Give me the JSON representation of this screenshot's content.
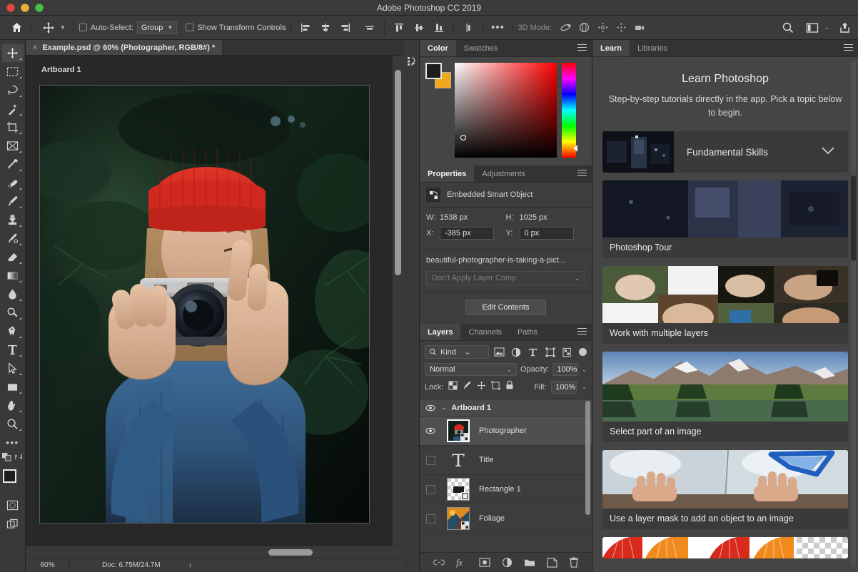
{
  "window": {
    "title": "Adobe Photoshop CC 2019",
    "traffic_lights": [
      "close",
      "minimize",
      "zoom"
    ]
  },
  "options_bar": {
    "home_icon": "home-icon",
    "tool_icon": "move-tool-icon",
    "auto_select_label": "Auto-Select:",
    "auto_select_checked": false,
    "group_value": "Group",
    "show_transform_label": "Show Transform Controls",
    "show_transform_checked": false,
    "align_icons": [
      "align-left-edges-icon",
      "align-horizontal-centers-icon",
      "align-right-edges-icon",
      "distribute-horizontally-icon",
      "align-top-edges-icon",
      "align-vertical-centers-icon",
      "align-bottom-edges-icon",
      "distribute-vertically-icon"
    ],
    "more_label": "•••",
    "mode_3d_label": "3D Mode:",
    "mode_3d_icons": [
      "orbit-3d-icon",
      "roll-3d-icon",
      "pan-3d-icon",
      "slide-3d-icon",
      "camera-3d-icon"
    ],
    "search_icon": "search-icon",
    "workspace_icon": "workspace-icon",
    "workspace_chevron": "chevron-down-icon",
    "share_icon": "share-icon"
  },
  "toolbar": {
    "tools": [
      {
        "name": "move-tool",
        "active": true
      },
      {
        "name": "rectangular-marquee-tool",
        "active": false
      },
      {
        "name": "lasso-tool",
        "active": false
      },
      {
        "name": "magic-wand-tool",
        "active": false
      },
      {
        "name": "crop-tool",
        "active": false
      },
      {
        "name": "frame-tool",
        "active": false
      },
      {
        "name": "eyedropper-tool",
        "active": false
      },
      {
        "name": "healing-brush-tool",
        "active": false
      },
      {
        "name": "brush-tool",
        "active": false
      },
      {
        "name": "clone-stamp-tool",
        "active": false
      },
      {
        "name": "history-brush-tool",
        "active": false
      },
      {
        "name": "eraser-tool",
        "active": false
      },
      {
        "name": "gradient-tool",
        "active": false
      },
      {
        "name": "blur-tool",
        "active": false
      },
      {
        "name": "dodge-tool",
        "active": false
      },
      {
        "name": "pen-tool",
        "active": false
      },
      {
        "name": "type-tool",
        "active": false
      },
      {
        "name": "path-selection-tool",
        "active": false
      },
      {
        "name": "rectangle-tool",
        "active": false
      },
      {
        "name": "hand-tool",
        "active": false
      },
      {
        "name": "zoom-tool",
        "active": false
      }
    ],
    "more_tools_label": "•••",
    "foreground_color": "#1d1d1d",
    "background_color": "#f0a81e",
    "quick_mask_icon": "quick-mask-icon",
    "screen_mode_icon": "screen-mode-icon"
  },
  "document": {
    "tab_label": "Example.psd @ 60% (Photographer, RGB/8#) *",
    "close_icon": "close-icon",
    "artboard_label": "Artboard 1"
  },
  "status_bar": {
    "zoom": "60%",
    "doc_info": "Doc: 6.75M/24.7M",
    "arrow": "›"
  },
  "color_panel": {
    "tabs": [
      {
        "label": "Color",
        "active": true
      },
      {
        "label": "Swatches",
        "active": false
      }
    ],
    "foreground_color": "#1d1d1d",
    "background_color": "#f0a81e"
  },
  "properties_panel": {
    "tabs": [
      {
        "label": "Properties",
        "active": true
      },
      {
        "label": "Adjustments",
        "active": false
      }
    ],
    "object_type": "Embedded Smart Object",
    "object_icon": "smart-object-icon",
    "width_label": "W:",
    "width_value": "1538 px",
    "height_label": "H:",
    "height_value": "1025 px",
    "x_label": "X:",
    "x_value": "-385 px",
    "y_label": "Y:",
    "y_value": "0 px",
    "file_name": "beautiful-photographer-is-taking-a-pict...",
    "layer_comp": "Don't Apply Layer Comp",
    "edit_contents_label": "Edit Contents"
  },
  "layers_panel": {
    "tabs": [
      {
        "label": "Layers",
        "active": true
      },
      {
        "label": "Channels",
        "active": false
      },
      {
        "label": "Paths",
        "active": false
      }
    ],
    "filter_label": "Kind",
    "filter_icons": [
      "pixel-filter-icon",
      "adjustment-filter-icon",
      "type-filter-icon",
      "shape-filter-icon",
      "smart-object-filter-icon"
    ],
    "blend_mode": "Normal",
    "opacity_label": "Opacity:",
    "opacity_value": "100%",
    "lock_label": "Lock:",
    "lock_icons": [
      "lock-transparent-pixels-icon",
      "lock-image-pixels-icon",
      "lock-position-icon",
      "lock-artboard-nesting-icon",
      "lock-all-icon"
    ],
    "fill_label": "Fill:",
    "fill_value": "100%",
    "layers": [
      {
        "name": "Artboard 1",
        "type": "group",
        "visible": true,
        "selected": false,
        "expanded": true
      },
      {
        "name": "Photographer",
        "type": "smart-object",
        "visible": true,
        "selected": true
      },
      {
        "name": "Title",
        "type": "text",
        "visible": false,
        "selected": false
      },
      {
        "name": "Rectangle 1",
        "type": "shape",
        "visible": false,
        "selected": false
      },
      {
        "name": "Foliage",
        "type": "smart-object",
        "visible": false,
        "selected": false
      }
    ],
    "footer_icons": [
      "link-layers-icon",
      "layer-style-fx-icon",
      "add-layer-mask-icon",
      "new-adjustment-layer-icon",
      "new-group-icon",
      "new-layer-icon",
      "delete-layer-icon"
    ]
  },
  "learn_panel": {
    "tabs": [
      {
        "label": "Learn",
        "active": true
      },
      {
        "label": "Libraries",
        "active": false
      }
    ],
    "title": "Learn Photoshop",
    "subtitle": "Step-by-step tutorials directly in the app. Pick a topic below to begin.",
    "skills_card": {
      "label": "Fundamental Skills",
      "chevron_icon": "chevron-down-icon"
    },
    "cards": [
      {
        "caption": "Photoshop Tour",
        "thumb": "dark-room-photo"
      },
      {
        "caption": "Work with multiple layers",
        "thumb": "hands-collage-photo"
      },
      {
        "caption": "Select part of an image",
        "thumb": "mountain-lake-photo"
      },
      {
        "caption": "Use a layer mask to add an object to an image",
        "thumb": "hands-window-photo"
      },
      {
        "caption": "",
        "thumb": "orange-red-fans-photo"
      }
    ]
  },
  "colors": {
    "app_background": "#323232",
    "panel_background": "#3d3d3d",
    "panel_header": "#333333",
    "canvas_background": "#282828",
    "accent_orange": "#f0a81e",
    "text_primary": "#e0e0e0",
    "text_secondary": "#a7a7a7"
  }
}
